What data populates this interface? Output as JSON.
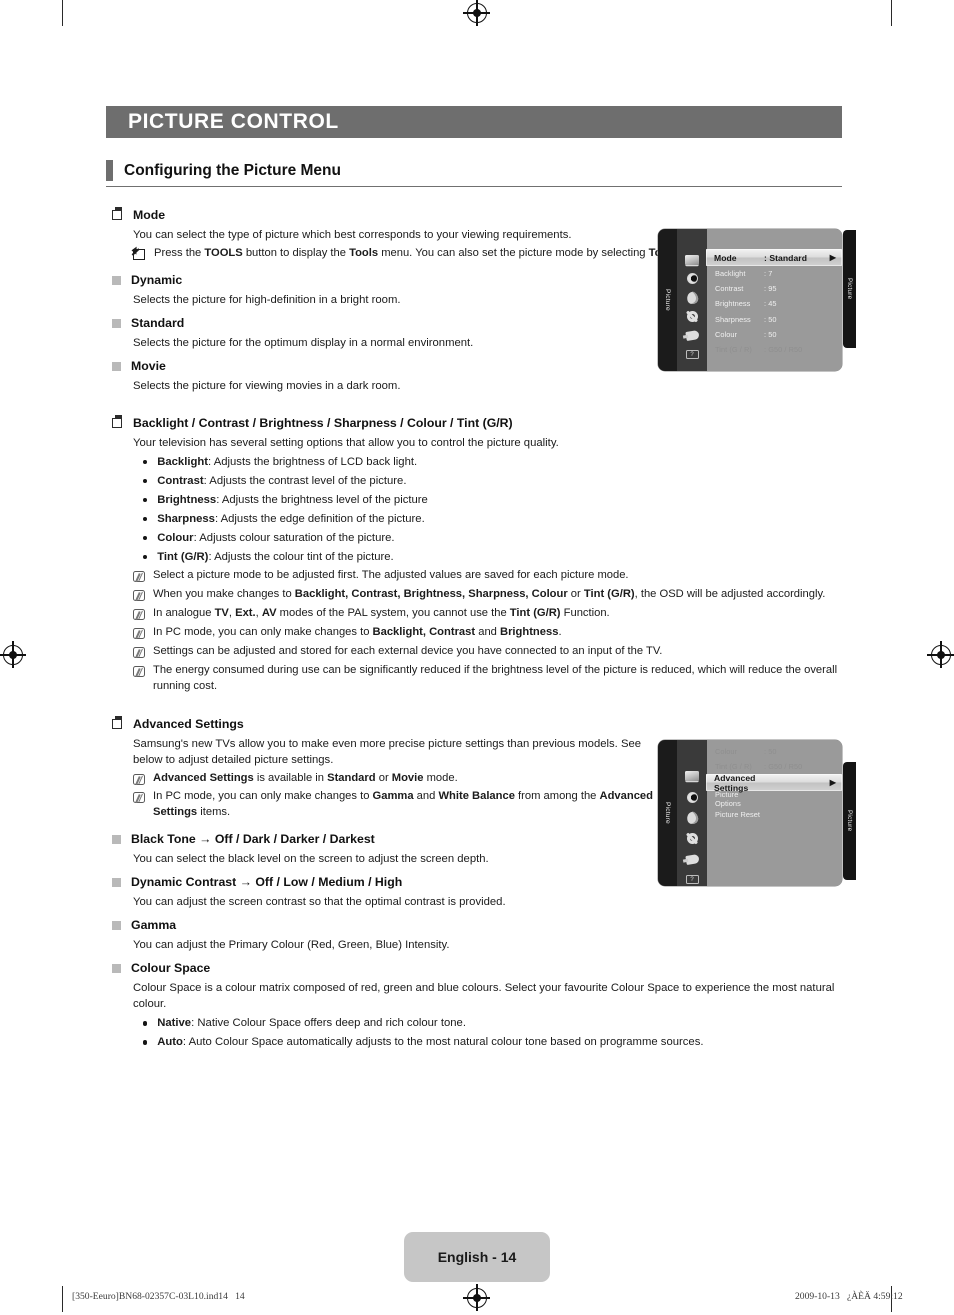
{
  "chapter": {
    "title": "PICTURE CONTROL"
  },
  "section": {
    "heading": "Configuring the Picture Menu"
  },
  "mode": {
    "heading": "Mode",
    "intro": "You can select the type of picture which best corresponds to your viewing requirements.",
    "tools_note": "Press the TOOLS button to display the Tools menu. You can also set the picture mode by selecting Tools → Picture Mode.",
    "items": [
      {
        "label": "Dynamic",
        "desc": "Selects the picture for high-definition in a bright room."
      },
      {
        "label": "Standard",
        "desc": "Selects the picture for the optimum display in a normal environment."
      },
      {
        "label": "Movie",
        "desc": "Selects the picture for viewing movies in a dark room."
      }
    ]
  },
  "adjustments": {
    "heading": "Backlight / Contrast / Brightness / Sharpness / Colour / Tint (G/R)",
    "intro": "Your television has several setting options that allow you to control the picture quality.",
    "bullets": [
      {
        "term": "Backlight",
        "desc": ": Adjusts the brightness of LCD back light."
      },
      {
        "term": "Contrast",
        "desc": ": Adjusts the contrast level of the picture."
      },
      {
        "term": "Brightness",
        "desc": ": Adjusts the brightness level of the picture"
      },
      {
        "term": "Sharpness",
        "desc": ": Adjusts the edge definition of the picture."
      },
      {
        "term": "Colour",
        "desc": ": Adjusts colour saturation of the picture."
      },
      {
        "term": "Tint (G/R)",
        "desc": ": Adjusts the colour tint of the picture."
      }
    ],
    "notes": [
      "Select a picture mode to be adjusted first. The adjusted values are saved for each picture mode.",
      "When you make changes to Backlight, Contrast, Brightness, Sharpness, Colour or Tint (G/R), the OSD will be adjusted accordingly.",
      "In analogue TV, Ext., AV modes of the PAL system, you cannot use the Tint (G/R) Function.",
      "In PC mode, you can only make changes to Backlight, Contrast and Brightness.",
      "Settings can be adjusted and stored for each external device you have connected to an input of the TV.",
      "The energy consumed during use can be significantly reduced if the brightness level of the picture is reduced, which will reduce the overall running cost."
    ]
  },
  "advanced": {
    "heading": "Advanced Settings",
    "intro": "Samsung's new TVs allow you to make even more precise picture settings than previous models. See below to adjust detailed picture settings.",
    "notes": [
      "Advanced Settings is available in Standard or Movie mode.",
      "In PC mode, you can only make changes to Gamma and White Balance from among the Advanced Settings items."
    ],
    "black_tone": {
      "heading": "Black Tone → Off / Dark / Darker / Darkest",
      "desc": "You can select the black level on the screen to adjust the screen depth."
    },
    "dynamic_contrast": {
      "heading": "Dynamic Contrast → Off / Low / Medium / High",
      "desc": "You can adjust the screen contrast so that the optimal contrast is provided."
    },
    "gamma": {
      "heading": "Gamma",
      "desc": "You can adjust the Primary Colour (Red, Green, Blue) Intensity."
    },
    "colour_space": {
      "heading": "Colour Space",
      "desc": "Colour Space is a colour matrix composed of red, green and blue colours. Select your favourite Colour Space to experience the most natural colour.",
      "bullets": [
        {
          "term": "Native",
          "desc": ": Native Colour Space offers deep and rich colour tone."
        },
        {
          "term": "Auto",
          "desc": ": Auto Colour Space automatically adjusts to the most natural colour tone based on programme sources."
        }
      ]
    }
  },
  "osd_menu_1": {
    "tab_label": "Picture",
    "edge_tab_label": "Picture",
    "rows": [
      {
        "label": "Mode",
        "value": ": Standard",
        "selected": true,
        "dim": false,
        "arrow": "▶"
      },
      {
        "label": "Backlight",
        "value": ": 7",
        "selected": false,
        "dim": false,
        "arrow": ""
      },
      {
        "label": "Contrast",
        "value": ": 95",
        "selected": false,
        "dim": false,
        "arrow": ""
      },
      {
        "label": "Brightness",
        "value": ": 45",
        "selected": false,
        "dim": false,
        "arrow": ""
      },
      {
        "label": "Sharpness",
        "value": ": 50",
        "selected": false,
        "dim": false,
        "arrow": ""
      },
      {
        "label": "Colour",
        "value": ": 50",
        "selected": false,
        "dim": false,
        "arrow": ""
      },
      {
        "label": "Tint (G / R)",
        "value": ": G50 / R50",
        "selected": false,
        "dim": true,
        "arrow": ""
      }
    ]
  },
  "osd_menu_2": {
    "tab_label": "Picture",
    "edge_tab_label": "Picture",
    "rows": [
      {
        "label": "Colour",
        "value": ": 50",
        "selected": false,
        "dim": true,
        "arrow": ""
      },
      {
        "label": "Tint (G / R)",
        "value": ": G50 / R50",
        "selected": false,
        "dim": true,
        "arrow": ""
      },
      {
        "label": "Advanced Settings",
        "value": "",
        "selected": true,
        "dim": false,
        "arrow": "▶"
      },
      {
        "label": "Picture Options",
        "value": "",
        "selected": false,
        "dim": false,
        "arrow": ""
      },
      {
        "label": "Picture Reset",
        "value": "",
        "selected": false,
        "dim": false,
        "arrow": ""
      }
    ]
  },
  "footer": {
    "page_label": "English - 14",
    "file_meta": "[350-Eeuro]BN68-02357C-03L10.ind14   14",
    "timestamp": "2009-10-13   ¿ÀÈÄ 4:59:12"
  }
}
